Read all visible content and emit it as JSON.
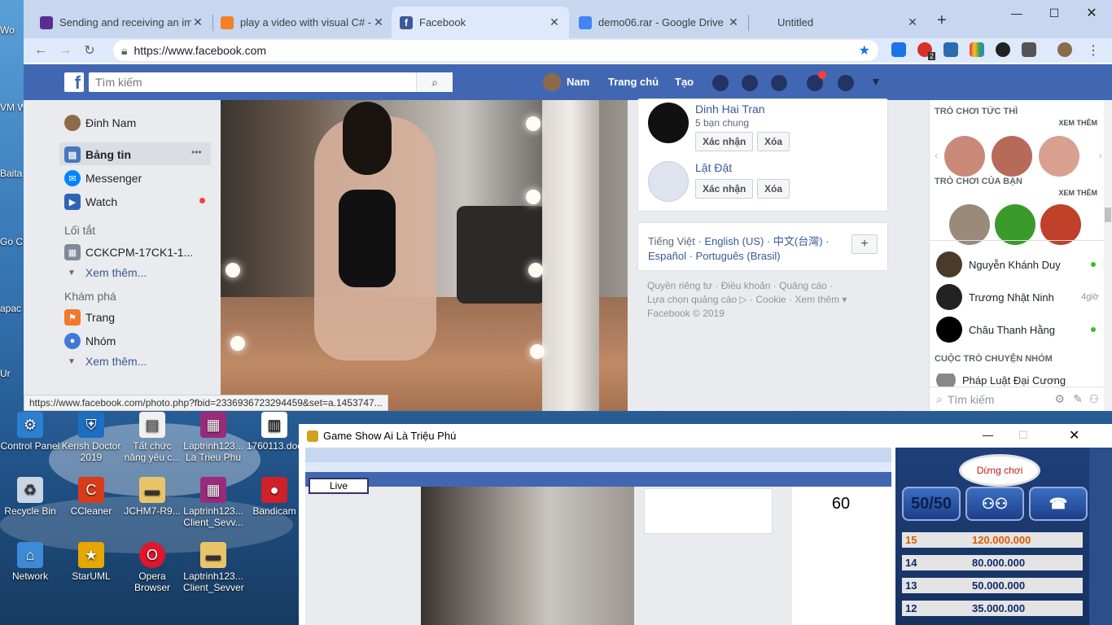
{
  "desktop": {
    "icons": [
      {
        "label": "Control Panel",
        "icon": "control-panel-icon",
        "color": "#2d7fd0"
      },
      {
        "label": "Kerish Doctor 2019",
        "icon": "shield-icon",
        "color": "#1b6ec2"
      },
      {
        "label": "Tất chức năng yêu c...",
        "icon": "document-icon",
        "color": "#f0f0f0"
      },
      {
        "label": "Laptrinh123... La Trieu Phu",
        "icon": "winrar-icon",
        "color": "#9a2b7a"
      },
      {
        "label": "1760113.doc",
        "icon": "barcode-icon",
        "color": "#ffffff"
      },
      {
        "label": "Recycle Bin",
        "icon": "recycle-bin-icon",
        "color": "#c9d6e3"
      },
      {
        "label": "CCleaner",
        "icon": "ccleaner-icon",
        "color": "#d83b1a"
      },
      {
        "label": "JCHM7-R9...",
        "icon": "folder-icon",
        "color": "#e9c46a"
      },
      {
        "label": "Laptrinh123... Client_Sevv...",
        "icon": "winrar-icon",
        "color": "#9a2b7a"
      },
      {
        "label": "Bandicam",
        "icon": "bandicam-icon",
        "color": "#d0202a"
      },
      {
        "label": "Network",
        "icon": "network-icon",
        "color": "#3d8bd6"
      },
      {
        "label": "StarUML",
        "icon": "staruml-icon",
        "color": "#e6a700"
      },
      {
        "label": "Opera Browser",
        "icon": "opera-icon",
        "color": "#e0162b"
      },
      {
        "label": "Laptrinh123... Client_Sevver",
        "icon": "folder-icon",
        "color": "#e9c46a"
      }
    ],
    "left_strip": [
      "Wo",
      "VM Wor",
      "Baita",
      "Go Chr",
      "apac",
      "Ur"
    ]
  },
  "browser": {
    "tabs": [
      {
        "title": "Sending and receiving an ima",
        "icon": "vs-icon",
        "color": "#5c2d91",
        "active": false
      },
      {
        "title": "play a video with visual C# - S",
        "icon": "stackoverflow-icon",
        "color": "#f48024",
        "active": false
      },
      {
        "title": "Facebook",
        "icon": "facebook-icon",
        "color": "#3b5998",
        "active": true
      },
      {
        "title": "demo06.rar - Google Drive",
        "icon": "drive-file-icon",
        "color": "#4285f4",
        "active": false
      },
      {
        "title": "Untitled",
        "icon": "",
        "color": "",
        "active": false
      }
    ],
    "new_tab": "+",
    "url": "https://www.facebook.com",
    "status_url": "https://www.facebook.com/photo.php?fbid=2336936723294459&set=a.1453747...",
    "extension_badges": {
      "mail": "2"
    }
  },
  "facebook": {
    "search_placeholder": "Tìm kiếm",
    "nav": {
      "user": "Nam",
      "home": "Trang chủ",
      "create": "Tạo"
    },
    "left": {
      "profile": "Đinh Nam",
      "items": [
        {
          "label": "Bảng tin",
          "icon": "news-feed-icon"
        },
        {
          "label": "Messenger",
          "icon": "messenger-icon"
        },
        {
          "label": "Watch",
          "icon": "watch-icon"
        }
      ],
      "more_dots": "•••",
      "shortcuts_head": "Lối tắt",
      "shortcut": "CCKCPM-17CK1-1...",
      "see_more": "Xem thêm...",
      "explore_head": "Khám phá",
      "explore": [
        {
          "label": "Trang",
          "icon": "flag-icon"
        },
        {
          "label": "Nhóm",
          "icon": "groups-icon"
        }
      ],
      "see_more2": "Xem thêm..."
    },
    "friends": [
      {
        "name": "Dinh Hai Tran",
        "mutual": "5 bạn chung",
        "confirm": "Xác nhận",
        "delete": "Xóa"
      },
      {
        "name": "Lật Đật",
        "mutual": "",
        "confirm": "Xác nhận",
        "delete": "Xóa"
      }
    ],
    "languages": {
      "line1": [
        "Tiếng Việt",
        "English (US)",
        "中文(台灣)"
      ],
      "line2": [
        "Español",
        "Português (Brasil)"
      ],
      "add": "+"
    },
    "footer": {
      "line1": [
        "Quyền riêng tư",
        "Điều khoản",
        "Quảng cáo"
      ],
      "line2": [
        "Lựa chọn quảng cáo ▷",
        "Cookie",
        "Xem thêm ▾"
      ],
      "copyright": "Facebook © 2019"
    },
    "right": {
      "instant_games": "TRÒ CHƠI TỨC THÌ",
      "your_games": "TRÒ CHƠI CỦA BẠN",
      "see_more": "XEM THÊM",
      "contacts": [
        {
          "name": "Nguyễn Khánh Duy",
          "status": "online"
        },
        {
          "name": "Trương Nhật Ninh",
          "status": "4giờ"
        },
        {
          "name": "Châu Thanh Hằng",
          "status": "online"
        }
      ],
      "group_chats": "CUỘC TRÒ CHUYỆN NHÓM",
      "group_item": "Pháp Luật Đại Cương",
      "search_placeholder": "Tìm kiếm"
    }
  },
  "game": {
    "title": "Game Show Ai Là Triệu Phú",
    "live_label": "Live",
    "timer": "60",
    "stop_label": "Dừng chơi",
    "lifelines": {
      "fifty": "50/50"
    },
    "prizes": [
      {
        "level": "15",
        "amount": "120.000.000",
        "highlight": true
      },
      {
        "level": "14",
        "amount": "80.000.000",
        "highlight": false
      },
      {
        "level": "13",
        "amount": "50.000.000",
        "highlight": false
      },
      {
        "level": "12",
        "amount": "35.000.000",
        "highlight": false
      }
    ]
  },
  "colors": {
    "fb_blue": "#4267b2",
    "fb_link": "#385898",
    "online": "#42b72a"
  }
}
